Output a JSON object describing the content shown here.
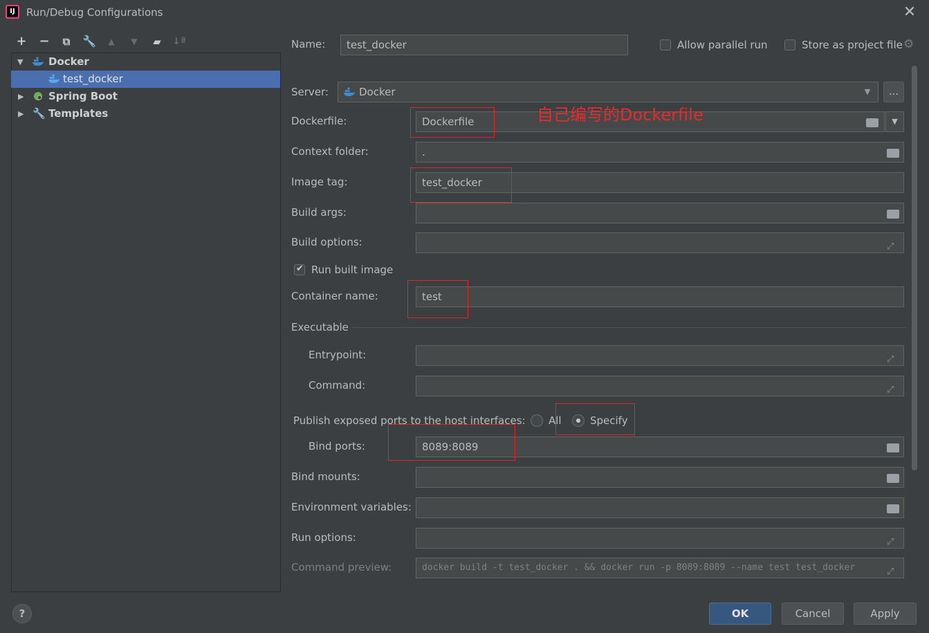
{
  "window": {
    "title": "Run/Debug Configurations",
    "app_icon_text": "IJ"
  },
  "toolbar": {
    "icons": [
      "add-icon",
      "remove-icon",
      "copy-icon",
      "wrench-icon",
      "move-up-icon",
      "move-down-icon",
      "new-folder-icon",
      "sort-icon"
    ]
  },
  "tree": {
    "docker": "Docker",
    "test_docker": "test_docker",
    "spring_boot": "Spring Boot",
    "templates": "Templates"
  },
  "form": {
    "name_label": "Name:",
    "name_value": "test_docker",
    "allow_parallel": "Allow parallel run",
    "store_as_project": "Store as project file",
    "server_label": "Server:",
    "server_value": "Docker",
    "server_more": "...",
    "dockerfile_label": "Dockerfile:",
    "dockerfile_value": "Dockerfile",
    "context_label": "Context folder:",
    "context_value": ".",
    "image_tag_label": "Image tag:",
    "image_tag_value": "test_docker",
    "build_args_label": "Build args:",
    "build_options_label": "Build options:",
    "run_built_image": "Run built image",
    "container_name_label": "Container name:",
    "container_name_value": "test",
    "executable_label": "Executable",
    "entrypoint_label": "Entrypoint:",
    "command_label": "Command:",
    "publish_label": "Publish exposed ports to the host interfaces:",
    "radio_all": "All",
    "radio_specify": "Specify",
    "bind_ports_label": "Bind ports:",
    "bind_ports_value": "8089:8089",
    "bind_mounts_label": "Bind mounts:",
    "env_label": "Environment variables:",
    "run_options_label": "Run options:",
    "cmd_preview_label": "Command preview:",
    "cmd_preview_value": "docker build -t test_docker . && docker run -p 8089:8089 --name test test_docker"
  },
  "annotation": "自己编写的Dockerfile",
  "buttons": {
    "help": "?",
    "ok": "OK",
    "cancel": "Cancel",
    "apply": "Apply"
  },
  "colors": {
    "background": "#3c3f41",
    "selection": "#4b6eaf",
    "annotation": "#e02828",
    "primary_button": "#365880"
  }
}
